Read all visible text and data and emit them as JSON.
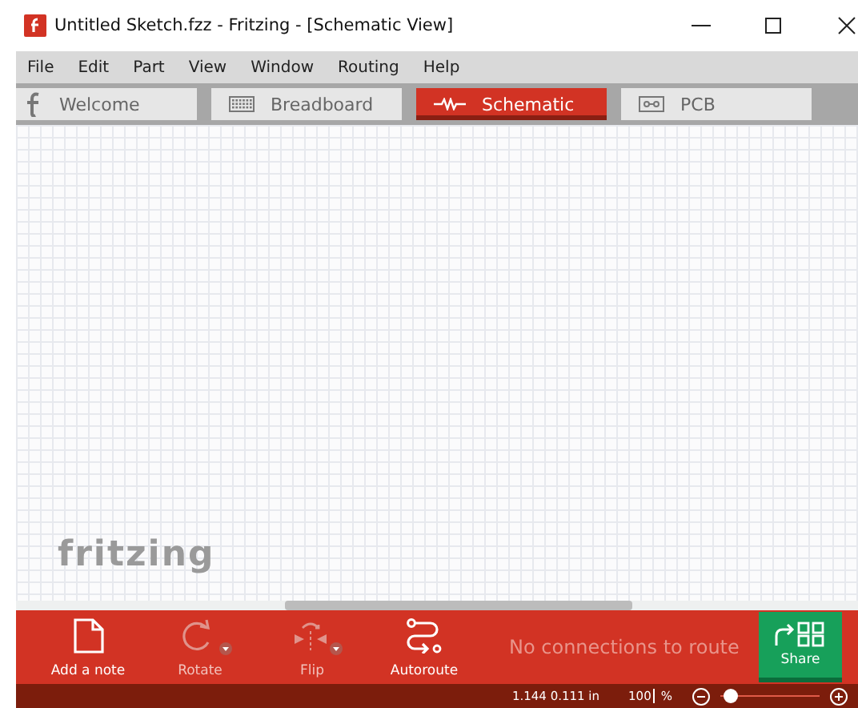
{
  "window": {
    "title": "Untitled Sketch.fzz - Fritzing - [Schematic View]"
  },
  "menu": [
    "File",
    "Edit",
    "Part",
    "View",
    "Window",
    "Routing",
    "Help"
  ],
  "tabs": [
    {
      "label": "Welcome",
      "kind": "welcome",
      "selected": false
    },
    {
      "label": "Breadboard",
      "kind": "breadboard",
      "selected": false
    },
    {
      "label": "Schematic",
      "kind": "schematic",
      "selected": true
    },
    {
      "label": "PCB",
      "kind": "pcb",
      "selected": false
    }
  ],
  "canvas": {
    "watermark": "fritzing"
  },
  "toolbar": {
    "tools": [
      {
        "label": "Add a note",
        "kind": "note",
        "disabled": false,
        "dropdown": false
      },
      {
        "label": "Rotate",
        "kind": "rotate",
        "disabled": true,
        "dropdown": true
      },
      {
        "label": "Flip",
        "kind": "flip",
        "disabled": true,
        "dropdown": true
      },
      {
        "label": "Autoroute",
        "kind": "autoroute",
        "disabled": false,
        "dropdown": false
      }
    ],
    "message": "No connections to route",
    "share": "Share"
  },
  "status_bar": {
    "coordinates": "1.144 0.111 in",
    "zoom": "100",
    "zoom_unit": "%",
    "zoom_slider": {
      "level": 0.1
    }
  }
}
